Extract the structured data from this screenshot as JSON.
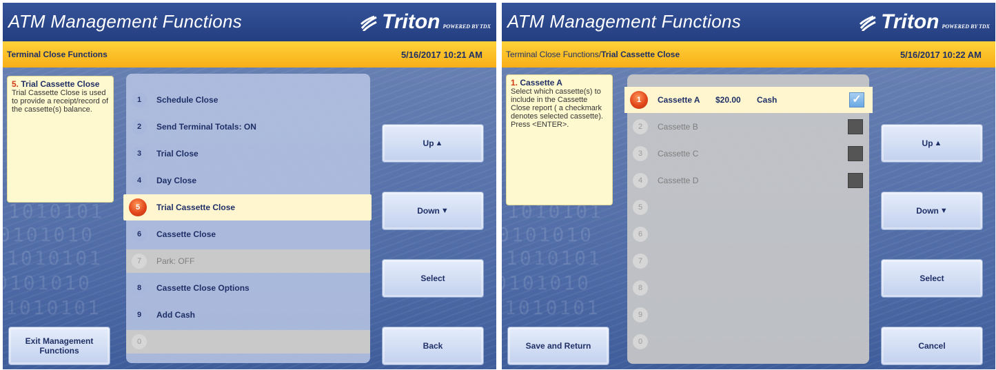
{
  "left": {
    "app_title": "ATM Management Functions",
    "brand": {
      "name": "Triton",
      "tagline": "POWERED BY TDX"
    },
    "breadcrumb": {
      "path": "Terminal Close Functions",
      "current": ""
    },
    "datetime": "5/16/2017  10:21 AM",
    "help": {
      "number": "5.",
      "title": "Trial Cassette Close",
      "text": "Trial Cassette Close is used to provide a receipt/record of the cassette(s) balance."
    },
    "options": [
      {
        "num": "1",
        "label": "Schedule Close"
      },
      {
        "num": "2",
        "label": "Send Terminal Totals: ON"
      },
      {
        "num": "3",
        "label": "Trial Close"
      },
      {
        "num": "4",
        "label": "Day Close"
      },
      {
        "num": "5",
        "label": "Trial Cassette Close"
      },
      {
        "num": "6",
        "label": "Cassette Close"
      },
      {
        "num": "7",
        "label": "Park: OFF"
      },
      {
        "num": "8",
        "label": "Cassette Close Options"
      },
      {
        "num": "9",
        "label": "Add Cash"
      },
      {
        "num": "0",
        "label": ""
      }
    ],
    "buttons": {
      "up": "Up",
      "down": "Down",
      "select": "Select",
      "back": "Back",
      "exit": "Exit Management Functions"
    },
    "icons": {
      "up_arrow": "▲",
      "down_arrow": "▼"
    },
    "binary_text": [
      "1010101",
      "0101010",
      "1010101",
      "0101010",
      "1010101"
    ]
  },
  "right": {
    "app_title": "ATM Management Functions",
    "brand": {
      "name": "Triton",
      "tagline": "POWERED BY TDX"
    },
    "breadcrumb": {
      "path": "Terminal Close Functions/",
      "current": "Trial Cassette Close"
    },
    "datetime": "5/16/2017  10:22 AM",
    "help": {
      "number": "1.",
      "title": "Cassette A",
      "text": "Select which cassette(s) to include in the Cassette Close report ( a checkmark denotes selected cassette). Press <ENTER>."
    },
    "cassettes": [
      {
        "num": "1",
        "name": "Cassette A",
        "amount": "$20.00",
        "type": "Cash",
        "checked": true
      },
      {
        "num": "2",
        "name": "Cassette B",
        "amount": "",
        "type": "",
        "checked": false
      },
      {
        "num": "3",
        "name": "Cassette C",
        "amount": "",
        "type": "",
        "checked": false
      },
      {
        "num": "4",
        "name": "Cassette D",
        "amount": "",
        "type": "",
        "checked": false
      },
      {
        "num": "5",
        "name": ""
      },
      {
        "num": "6",
        "name": ""
      },
      {
        "num": "7",
        "name": ""
      },
      {
        "num": "8",
        "name": ""
      },
      {
        "num": "9",
        "name": ""
      },
      {
        "num": "0",
        "name": ""
      }
    ],
    "buttons": {
      "up": "Up",
      "down": "Down",
      "select": "Select",
      "cancel": "Cancel",
      "save_return": "Save and Return"
    },
    "icons": {
      "up_arrow": "▲",
      "down_arrow": "▼",
      "check": "✓"
    },
    "binary_text": [
      "1010101",
      "0101010",
      "1010101",
      "0101010",
      "1010101"
    ]
  },
  "colors": {
    "title_bar": "#243f80",
    "breadcrumb_bar": "#f8ae17",
    "highlight_row": "#fff6d0",
    "selected_badge": "#e2461b",
    "text_navy": "#1e2f66"
  }
}
